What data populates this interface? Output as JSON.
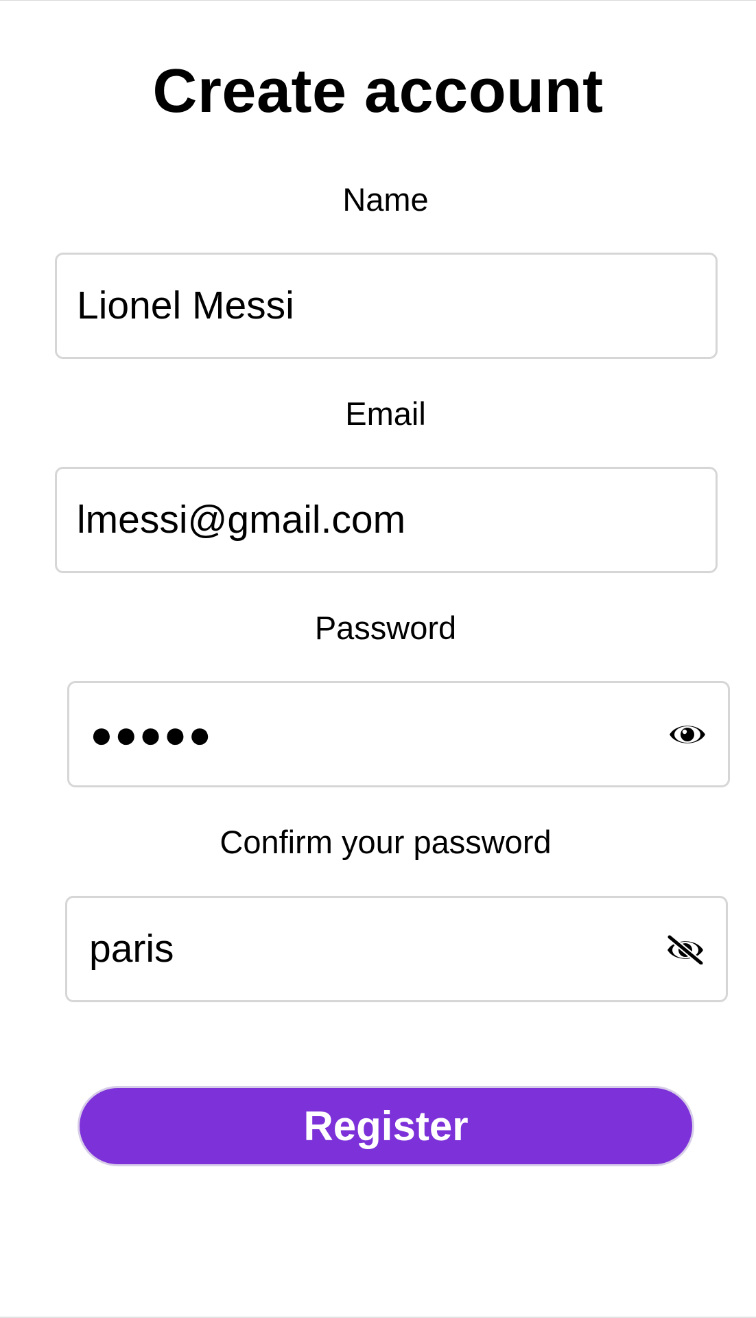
{
  "page": {
    "title": "Create account"
  },
  "form": {
    "name": {
      "label": "Name",
      "value": "Lionel Messi"
    },
    "email": {
      "label": "Email",
      "value": "lmessi@gmail.com"
    },
    "password": {
      "label": "Password",
      "masked_value": "●●●●●",
      "visibility_icon": "eye-icon"
    },
    "confirm_password": {
      "label": "Confirm your password",
      "value": "paris",
      "visibility_icon": "eye-off-icon"
    },
    "submit_label": "Register"
  },
  "colors": {
    "accent": "#7D32D9",
    "field_border": "#D6D6D6",
    "text": "#000000"
  }
}
